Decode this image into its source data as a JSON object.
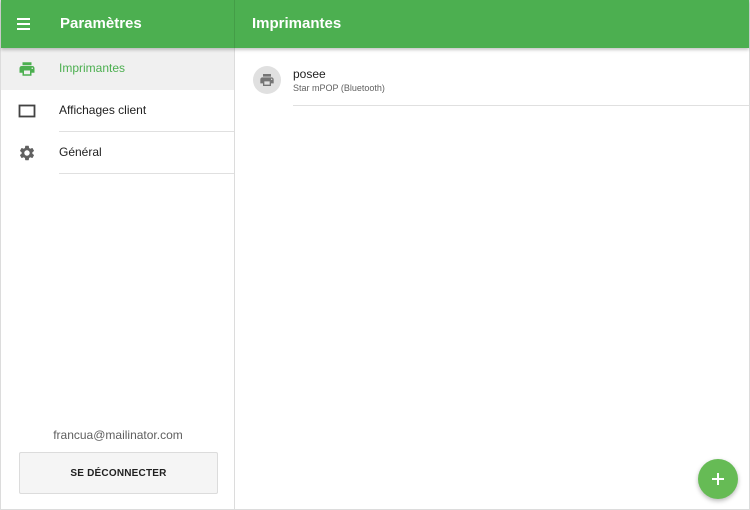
{
  "header": {
    "menu_icon": "hamburger-menu-icon",
    "settings_title": "Paramètres",
    "page_title": "Imprimantes",
    "brand_color": "#4caf50"
  },
  "sidebar": {
    "items": [
      {
        "label": "Imprimantes",
        "icon": "printer-icon",
        "active": true
      },
      {
        "label": "Affichages client",
        "icon": "monitor-icon",
        "active": false
      },
      {
        "label": "Général",
        "icon": "gear-icon",
        "active": false
      }
    ],
    "user_email": "francua@mailinator.com",
    "logout_label": "SE DÉCONNECTER"
  },
  "main": {
    "printers": [
      {
        "name": "posee",
        "model": "Star mPOP (Bluetooth)",
        "icon": "printer-icon"
      }
    ]
  },
  "fab": {
    "icon": "plus-icon",
    "color": "#66bb55"
  }
}
